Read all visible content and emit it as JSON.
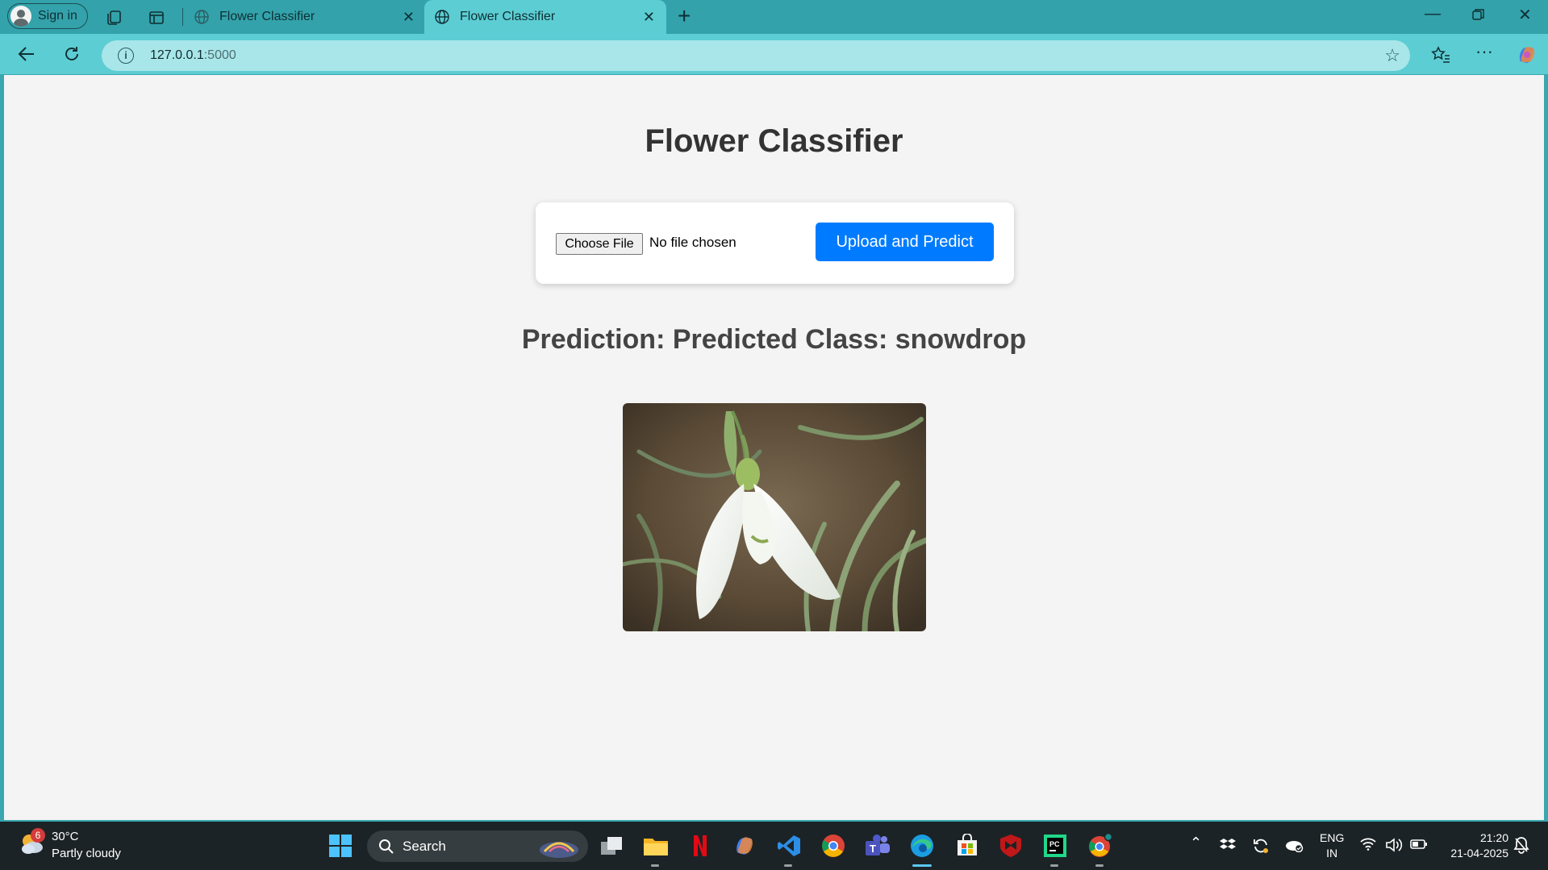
{
  "browser": {
    "signin_label": "Sign in",
    "tabs": [
      {
        "title": "Flower Classifier"
      },
      {
        "title": "Flower Classifier"
      }
    ],
    "address": {
      "host": "127.0.0.1",
      "port": ":5000"
    }
  },
  "page": {
    "title": "Flower Classifier",
    "file_input": {
      "button_label": "Choose File",
      "status": "No file chosen"
    },
    "upload_button": "Upload and Predict",
    "prediction": "Prediction: Predicted Class: snowdrop"
  },
  "taskbar": {
    "weather": {
      "badge": "6",
      "temperature": "30°C",
      "condition": "Partly cloudy"
    },
    "search_label": "Search",
    "language": {
      "line1": "ENG",
      "line2": "IN"
    },
    "clock": {
      "time": "21:20",
      "date": "21-04-2025"
    }
  },
  "colors": {
    "tab_bar": "#33a2ab",
    "toolbar": "#5ccdd3",
    "page_bg": "#f4f4f4",
    "upload_button": "#007bff",
    "taskbar": "#1c2326"
  }
}
